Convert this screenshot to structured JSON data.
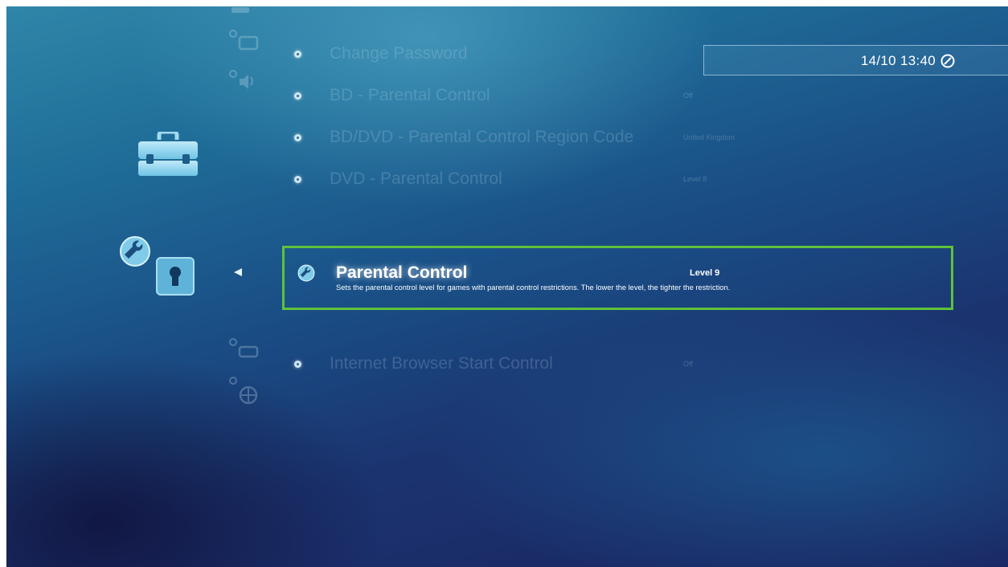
{
  "clock": {
    "time": "14/10 13:40",
    "icon": "clock-icon"
  },
  "category": {
    "icon": "toolbox-icon"
  },
  "current_column": {
    "icons": [
      "wrench-icon",
      "keyhole-icon"
    ]
  },
  "menu": {
    "items_above": [
      {
        "label": "Change Password",
        "value": ""
      },
      {
        "label": "BD - Parental Control",
        "value": "Off"
      },
      {
        "label": "BD/DVD - Parental Control Region Code",
        "value": "United Kingdom"
      },
      {
        "label": "DVD - Parental Control",
        "value": "Level 8"
      }
    ],
    "selected": {
      "label": "Parental Control",
      "value": "Level 9",
      "description": "Sets the parental control level for games with parental control restrictions. The lower the level, the tighter the restriction.",
      "icon": "wrench-icon"
    },
    "items_below": [
      {
        "label": "Internet Browser Start Control",
        "value": "Off"
      }
    ]
  },
  "colors": {
    "selection_border": "#5fc23a",
    "background_top": "#2f86a8",
    "background_bottom": "#1a2460"
  }
}
